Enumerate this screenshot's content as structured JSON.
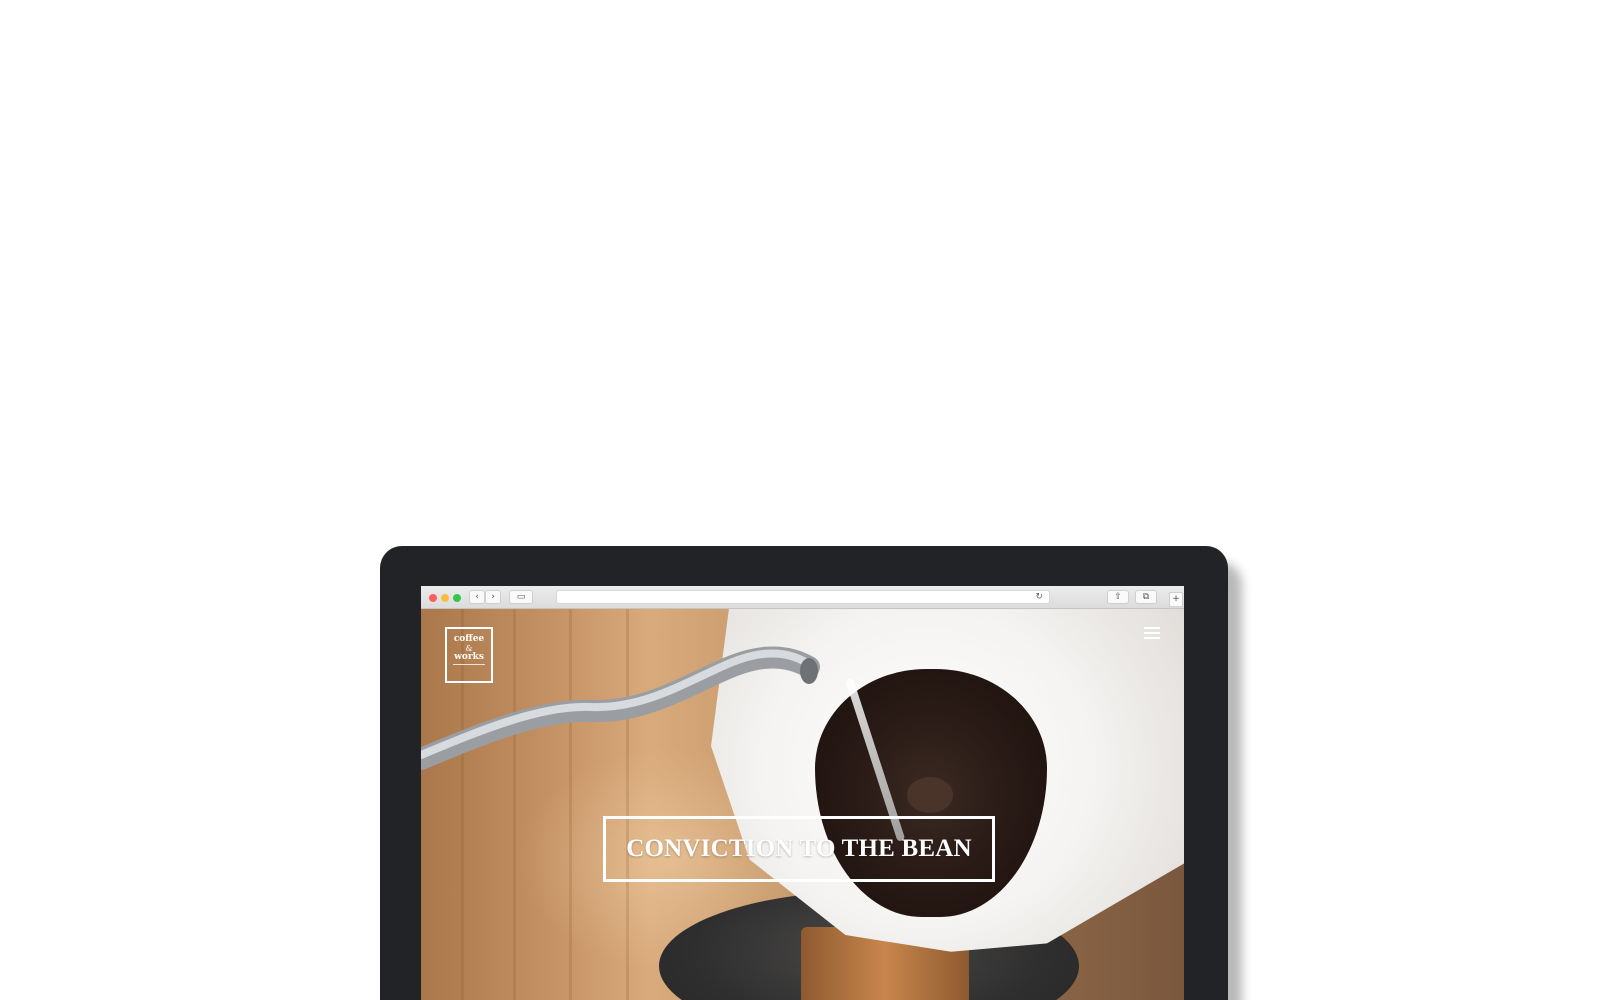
{
  "browser": {
    "back_label": "‹",
    "forward_label": "›",
    "sidebar_label": "▭",
    "reload_label": "↻",
    "share_label": "⇧",
    "tabs_label": "⧉",
    "new_tab_label": "+"
  },
  "site": {
    "logo": {
      "line1": "coffee",
      "amp": "&",
      "line2": "works",
      "tagline": "CONVICTION TO THE BEAN"
    },
    "hero": {
      "headline": "CONVICTION TO THE BEAN"
    }
  },
  "colors": {
    "bezel": "#222326",
    "headline": "#ffffff",
    "traffic_red": "#fc605b",
    "traffic_yellow": "#fdbc40",
    "traffic_green": "#34c84a"
  },
  "icons": {
    "menu": "hamburger-menu-icon",
    "reload": "reload-icon",
    "share": "share-icon",
    "tabs": "tabs-icon"
  }
}
